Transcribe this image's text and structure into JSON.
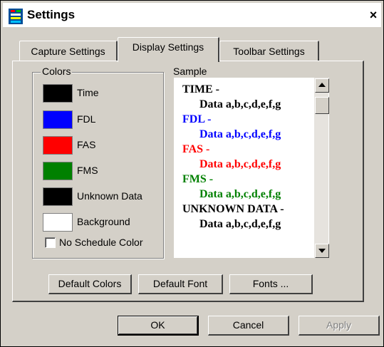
{
  "window": {
    "title": "Settings",
    "close_label": "×"
  },
  "tabs": [
    {
      "label": "Capture Settings"
    },
    {
      "label": "Display Settings"
    },
    {
      "label": "Toolbar Settings"
    }
  ],
  "colors_group": {
    "label": "Colors",
    "items": [
      {
        "label": "Time",
        "color": "#000000"
      },
      {
        "label": "FDL",
        "color": "#0000ff"
      },
      {
        "label": "FAS",
        "color": "#ff0000"
      },
      {
        "label": "FMS",
        "color": "#008000"
      },
      {
        "label": "Unknown Data",
        "color": "#000000"
      },
      {
        "label": "Background",
        "color": "#ffffff"
      }
    ],
    "no_schedule_color": {
      "label": "No Schedule Color",
      "checked": false
    }
  },
  "sample": {
    "label": "Sample",
    "lines": [
      {
        "text": "TIME -",
        "color": "#000000",
        "indent": false
      },
      {
        "text": "Data a,b,c,d,e,f,g",
        "color": "#000000",
        "indent": true
      },
      {
        "text": "FDL -",
        "color": "#0000ff",
        "indent": false
      },
      {
        "text": "Data a,b,c,d,e,f,g",
        "color": "#0000ff",
        "indent": true
      },
      {
        "text": "FAS -",
        "color": "#ff0000",
        "indent": false
      },
      {
        "text": "Data a,b,c,d,e,f,g",
        "color": "#ff0000",
        "indent": true
      },
      {
        "text": "FMS -",
        "color": "#008000",
        "indent": false
      },
      {
        "text": "Data a,b,c,d,e,f,g",
        "color": "#008000",
        "indent": true
      },
      {
        "text": "UNKNOWN DATA -",
        "color": "#000000",
        "indent": false
      },
      {
        "text": "Data a,b,c,d,e,f,g",
        "color": "#000000",
        "indent": true
      }
    ]
  },
  "panel_buttons": {
    "default_colors": "Default Colors",
    "default_font": "Default Font",
    "fonts": "Fonts ..."
  },
  "dialog_buttons": {
    "ok": "OK",
    "cancel": "Cancel",
    "apply": "Apply"
  }
}
